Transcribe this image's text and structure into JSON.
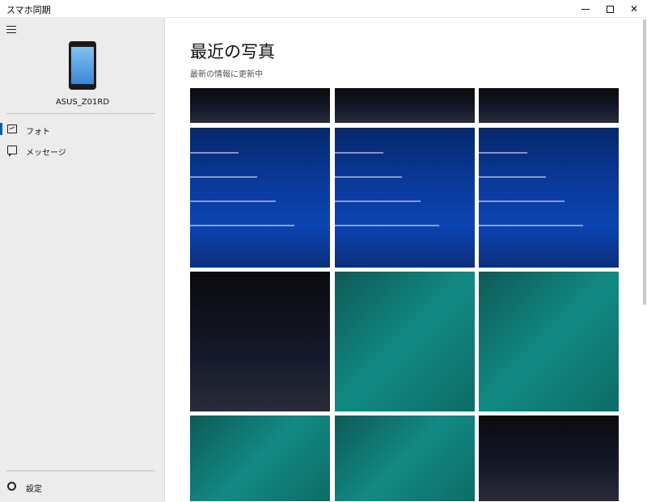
{
  "window": {
    "title": "スマホ同期"
  },
  "sidebar": {
    "device_name": "ASUS_Z01RD",
    "items": [
      {
        "label": "フォト",
        "icon": "photo-icon",
        "active": true
      },
      {
        "label": "メッセージ",
        "icon": "message-icon",
        "active": false
      }
    ],
    "settings_label": "設定",
    "accent_color": "#0063b1"
  },
  "main": {
    "title": "最近の写真",
    "subtitle": "最新の情報に更新中"
  },
  "photos": {
    "rows": 4,
    "columns": 3,
    "tiles": [
      {
        "kind": "dark"
      },
      {
        "kind": "dark"
      },
      {
        "kind": "dark"
      },
      {
        "kind": "blue"
      },
      {
        "kind": "blue"
      },
      {
        "kind": "blue"
      },
      {
        "kind": "dark"
      },
      {
        "kind": "teal"
      },
      {
        "kind": "teal"
      },
      {
        "kind": "teal"
      },
      {
        "kind": "teal"
      },
      {
        "kind": "dark"
      }
    ]
  }
}
